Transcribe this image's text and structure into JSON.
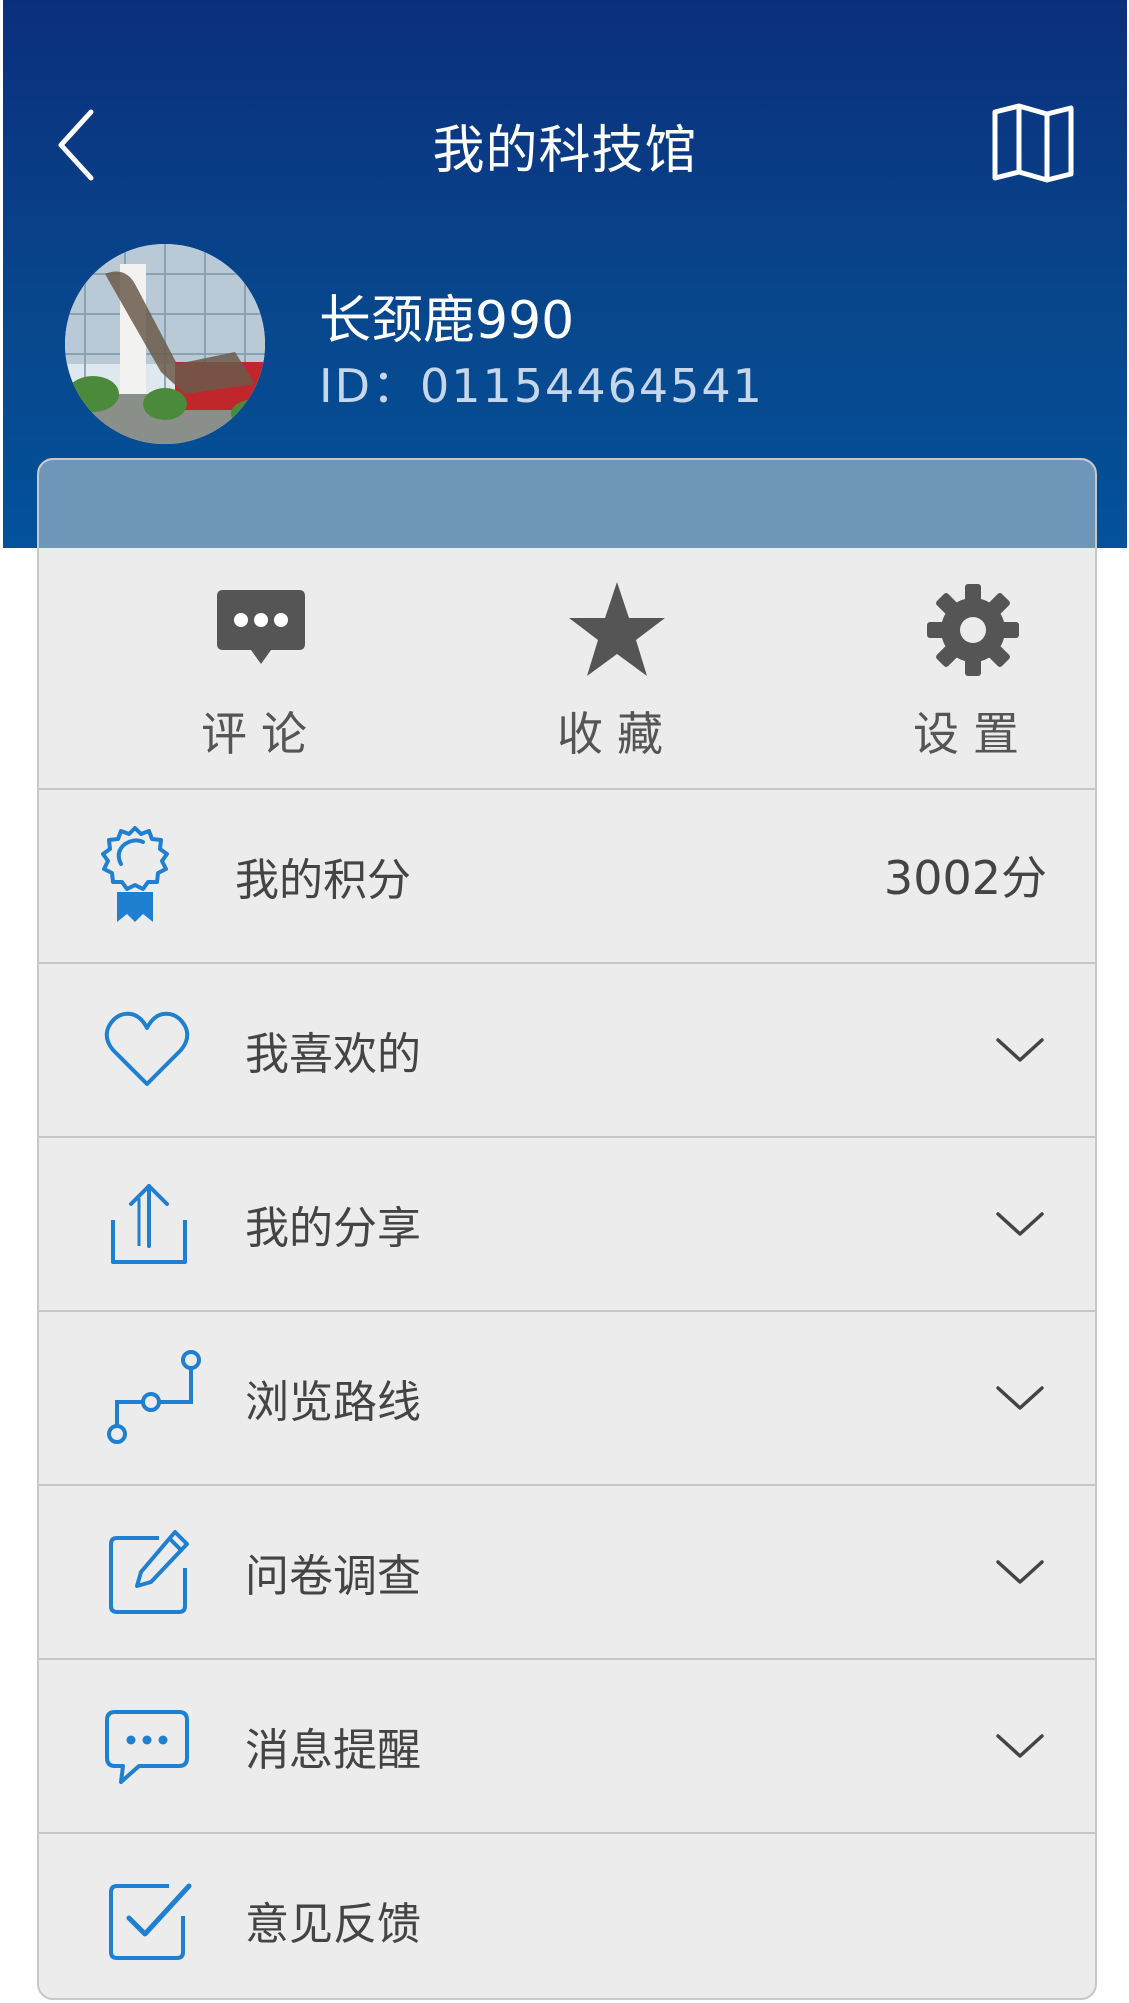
{
  "header": {
    "title": "我的科技馆",
    "back_icon": "chevron-left-icon",
    "map_icon": "map-icon",
    "bg_color": "#0b3f86"
  },
  "profile": {
    "username": "长颈鹿990",
    "user_id": "ID：01154464541"
  },
  "quick_actions": [
    {
      "label": "评论",
      "icon": "comment-icon"
    },
    {
      "label": "收藏",
      "icon": "star-icon"
    },
    {
      "label": "设置",
      "icon": "gear-icon"
    }
  ],
  "points": {
    "label": "我的积分",
    "value": "3002分",
    "icon": "badge-icon"
  },
  "menu": [
    {
      "label": "我喜欢的",
      "icon": "heart-icon"
    },
    {
      "label": "我的分享",
      "icon": "share-icon"
    },
    {
      "label": "浏览路线",
      "icon": "route-icon"
    },
    {
      "label": "问卷调查",
      "icon": "edit-icon"
    },
    {
      "label": "消息提醒",
      "icon": "message-icon"
    },
    {
      "label": "意见反馈",
      "icon": "feedback-icon"
    }
  ],
  "colors": {
    "accent": "#1f7fd0",
    "icon_dark": "#555555",
    "panel_bg": "#ececec"
  }
}
